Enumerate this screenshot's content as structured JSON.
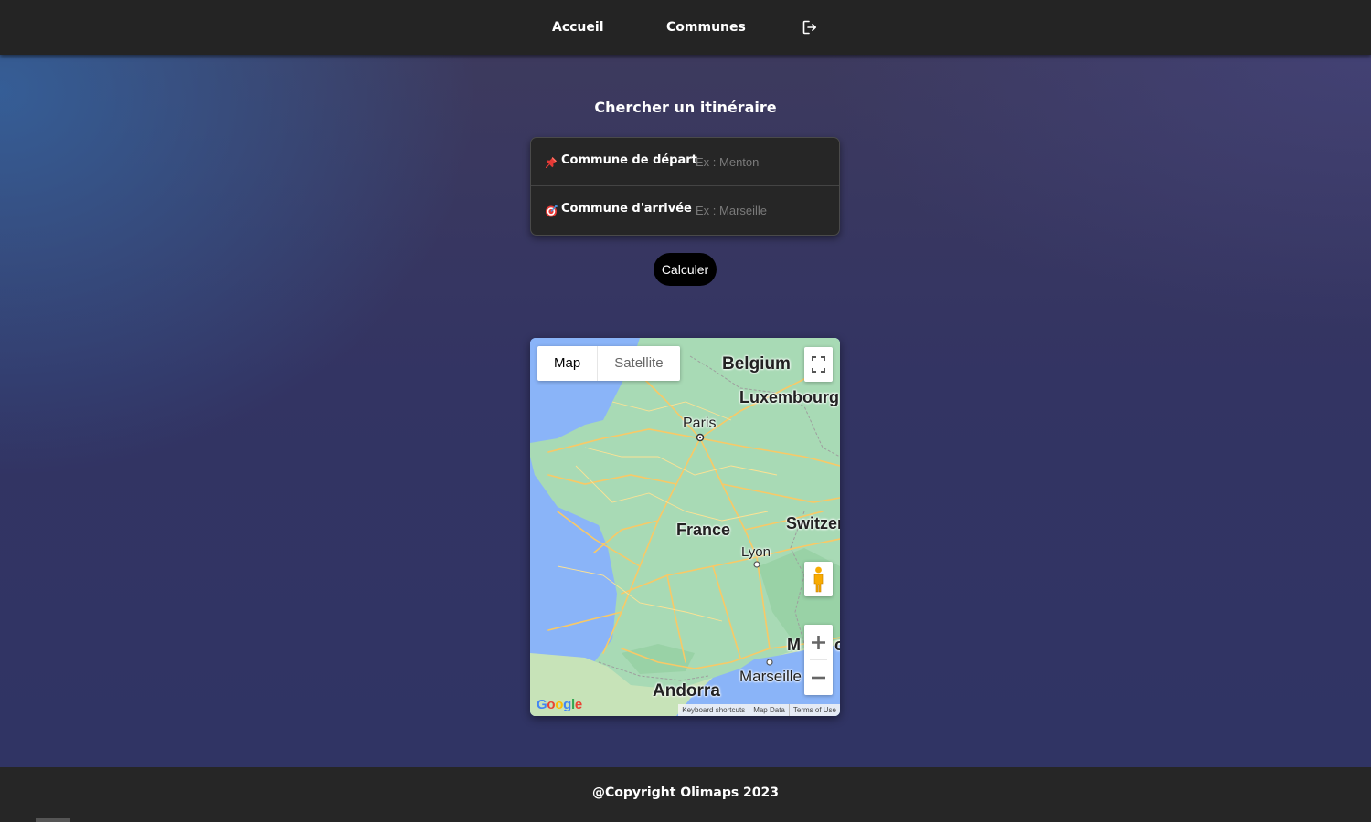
{
  "nav": {
    "items": [
      {
        "label": "Accueil"
      },
      {
        "label": "Communes"
      }
    ],
    "logout_icon": "logout-icon"
  },
  "main": {
    "title": "Chercher un itinéraire",
    "form": {
      "departure": {
        "icon": "pushpin-icon",
        "label": "Commune de départ",
        "placeholder": "Ex : Menton",
        "value": ""
      },
      "arrival": {
        "icon": "target-icon",
        "label": "Commune d'arrivée",
        "placeholder": "Ex : Marseille",
        "value": ""
      }
    },
    "calculate_label": "Calculer"
  },
  "map": {
    "type_options": [
      "Map",
      "Satellite"
    ],
    "selected_type": "Map",
    "labels": {
      "belgium": "Belgium",
      "luxembourg": "Luxembourg",
      "paris": "Paris",
      "france": "France",
      "switzerland": "Switzer",
      "lyon": "Lyon",
      "monaco_left": "M",
      "monaco_right": "c",
      "marseille": "Marseille",
      "andorra": "Andorra"
    },
    "logo": "Google",
    "attribution": [
      "Keyboard shortcuts",
      "Map Data",
      "Terms of Use"
    ],
    "controls": {
      "fullscreen_icon": "fullscreen-icon",
      "pegman_icon": "pegman-icon",
      "zoom_in": "+",
      "zoom_out": "−"
    },
    "colors": {
      "water": "#8ab4f8",
      "land": "#a8dab5",
      "road": "#f8c967"
    }
  },
  "footer": {
    "copyright": "@Copyright Olimaps 2023"
  }
}
